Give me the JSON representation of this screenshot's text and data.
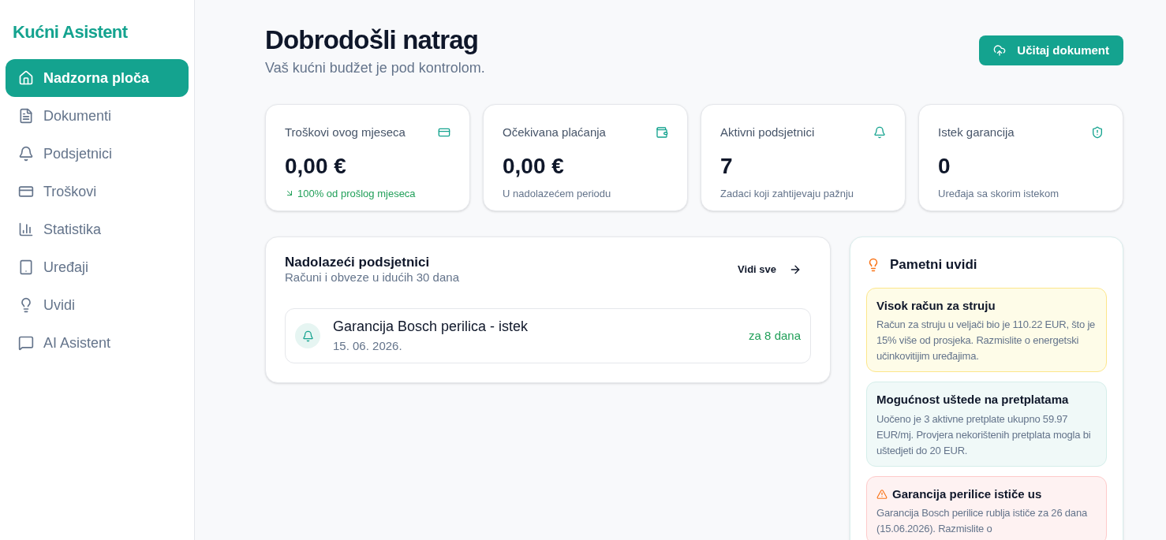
{
  "sidebar": {
    "brand": "Kućni Asistent",
    "items": [
      {
        "label": "Nadzorna ploča",
        "selected": true
      },
      {
        "label": "Dokumenti",
        "selected": false
      },
      {
        "label": "Podsjetnici",
        "selected": false
      },
      {
        "label": "Troškovi",
        "selected": false
      },
      {
        "label": "Statistika",
        "selected": false
      },
      {
        "label": "Uređaji",
        "selected": false
      },
      {
        "label": "Uvidi",
        "selected": false
      },
      {
        "label": "AI Asistent",
        "selected": false
      }
    ]
  },
  "header": {
    "title": "Dobrodošli natrag",
    "subtitle": "Vaš kućni budžet je pod kontrolom.",
    "upload_button": "Učitaj dokument"
  },
  "stats": [
    {
      "kind": "trend",
      "label": "Troškovi ovog mjeseca",
      "value": "0,00 €",
      "note": "100% od prošlog mjeseca"
    },
    {
      "kind": "plain",
      "label": "Očekivana plaćanja",
      "value": "0,00 €",
      "note": "U nadolazećem periodu"
    },
    {
      "kind": "plain",
      "label": "Aktivni podsjetnici",
      "value": "7",
      "note": "Zadaci koji zahtijevaju pažnju"
    },
    {
      "kind": "plain",
      "label": "Istek garancija",
      "value": "0",
      "note": "Uređaja sa skorim istekom"
    }
  ],
  "reminders": {
    "title": "Nadolazeći podsjetnici",
    "subtitle": "Računi i obveze u idućih 30 dana",
    "see_all": "Vidi sve",
    "items": [
      {
        "title": "Garancija Bosch perilica - istek",
        "date": "15. 06. 2026.",
        "due": "za 8 dana"
      }
    ]
  },
  "insights": {
    "title": "Pametni uvidi",
    "items": [
      {
        "kind": "warning",
        "title": "Visok račun za struju",
        "text": "Račun za struju u veljači bio je 110.22 EUR, što je 15% više od prosjeka. Razmislite o energetski učinkovitijim uređajima."
      },
      {
        "kind": "info",
        "title": "Mogućnost uštede na pretplatama",
        "text": "Uočeno je 3 aktivne pretplate ukupno 59.97 EUR/mj. Provjera nekorištenih pretplata mogla bi uštedjeti do 20 EUR."
      },
      {
        "kind": "alert",
        "title": "Garancija perilice ističe us",
        "text": "Garancija Bosch perilice rublja ističe za 26 dana (15.06.2026). Razmislite o"
      }
    ]
  }
}
